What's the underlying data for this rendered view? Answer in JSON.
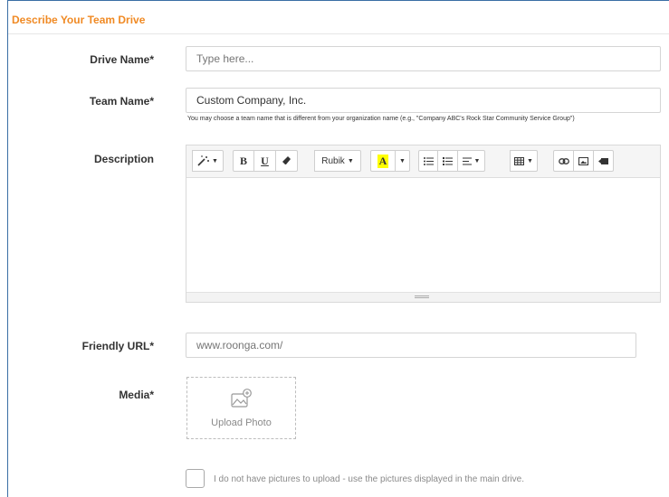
{
  "section": {
    "title": "Describe Your Team Drive"
  },
  "fields": {
    "drive_name": {
      "label": "Drive Name*",
      "placeholder": "Type here..."
    },
    "team_name": {
      "label": "Team Name*",
      "value": "Custom Company, Inc.",
      "hint": "You may choose a team name that is different from your organization name (e.g., \"Company ABC's Rock Star Community Service Group\")"
    },
    "description": {
      "label": "Description",
      "toolbar": {
        "font_name": "Rubik",
        "bold": "B",
        "underline": "U",
        "font_color": "A"
      }
    },
    "friendly_url": {
      "label": "Friendly URL*",
      "placeholder": "www.roonga.com/"
    },
    "media": {
      "label": "Media*",
      "upload_label": "Upload Photo"
    }
  },
  "no_pictures": {
    "label": "I do not have pictures to upload - use the pictures displayed in the main drive.",
    "checked": false
  },
  "colors": {
    "accent": "#f08a24",
    "frame_border": "#3a6ea5",
    "highlight": "#ffff00"
  }
}
